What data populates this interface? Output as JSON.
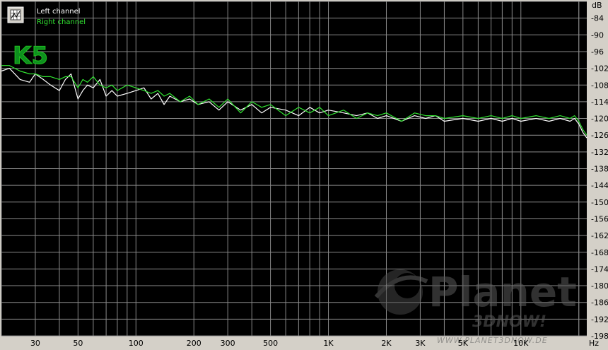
{
  "chart_data": {
    "type": "line",
    "title": "",
    "xlabel": "",
    "ylabel": "",
    "x_unit": "Hz",
    "y_unit": "dB",
    "x_scale": "log",
    "xlim": [
      20,
      22000
    ],
    "ylim": [
      -198,
      -78
    ],
    "grid": true,
    "legend": "top-left",
    "x_ticks": [
      {
        "value": 30,
        "label": "30"
      },
      {
        "value": 50,
        "label": "50"
      },
      {
        "value": 100,
        "label": "100"
      },
      {
        "value": 200,
        "label": "200"
      },
      {
        "value": 300,
        "label": "300"
      },
      {
        "value": 500,
        "label": "500"
      },
      {
        "value": 1000,
        "label": "1K"
      },
      {
        "value": 2000,
        "label": "2K"
      },
      {
        "value": 3000,
        "label": "3K"
      },
      {
        "value": 5000,
        "label": "5K"
      },
      {
        "value": 10000,
        "label": "10K"
      }
    ],
    "y_ticks": [
      {
        "value": -84,
        "label": "-84"
      },
      {
        "value": -90,
        "label": "-90"
      },
      {
        "value": -96,
        "label": "-96"
      },
      {
        "value": -102,
        "label": "-102"
      },
      {
        "value": -108,
        "label": "-108"
      },
      {
        "value": -114,
        "label": "-114"
      },
      {
        "value": -120,
        "label": "-120"
      },
      {
        "value": -126,
        "label": "-126"
      },
      {
        "value": -132,
        "label": "-132"
      },
      {
        "value": -138,
        "label": "-138"
      },
      {
        "value": -144,
        "label": "-144"
      },
      {
        "value": -150,
        "label": "-150"
      },
      {
        "value": -156,
        "label": "-156"
      },
      {
        "value": -162,
        "label": "-162"
      },
      {
        "value": -168,
        "label": "-168"
      },
      {
        "value": -174,
        "label": "-174"
      },
      {
        "value": -180,
        "label": "-180"
      },
      {
        "value": -186,
        "label": "-186"
      },
      {
        "value": -192,
        "label": "-192"
      },
      {
        "value": -198,
        "label": "-198"
      }
    ],
    "series": [
      {
        "name": "Left channel",
        "color": "#ffffff",
        "x": [
          20,
          22,
          25,
          28,
          30,
          33,
          36,
          40,
          43,
          46,
          50,
          53,
          56,
          60,
          65,
          70,
          75,
          80,
          90,
          100,
          110,
          120,
          130,
          140,
          150,
          170,
          190,
          210,
          240,
          270,
          300,
          350,
          400,
          450,
          500,
          600,
          700,
          800,
          900,
          1000,
          1200,
          1400,
          1600,
          1800,
          2000,
          2400,
          2800,
          3200,
          3600,
          4000,
          5000,
          6000,
          7000,
          8000,
          9000,
          10000,
          12000,
          14000,
          16000,
          18000,
          19000,
          20000,
          21000,
          22000
        ],
        "y": [
          -103,
          -102,
          -106,
          -107,
          -104,
          -106,
          -108,
          -110,
          -106,
          -104,
          -113,
          -110,
          -108,
          -109,
          -106,
          -112,
          -110,
          -112,
          -111,
          -110,
          -109,
          -113,
          -111,
          -115,
          -112,
          -114,
          -113,
          -115,
          -114,
          -117,
          -114,
          -117,
          -115,
          -118,
          -116,
          -117,
          -119,
          -116,
          -118,
          -117,
          -118,
          -119,
          -118,
          -120,
          -119,
          -121,
          -119,
          -120,
          -119,
          -121,
          -120,
          -121,
          -120,
          -121,
          -120,
          -121,
          -120,
          -121,
          -120,
          -121,
          -120,
          -122,
          -125,
          -127
        ]
      },
      {
        "name": "Right channel",
        "color": "#31e331",
        "x": [
          20,
          22,
          25,
          28,
          30,
          33,
          36,
          40,
          43,
          46,
          50,
          53,
          56,
          60,
          65,
          70,
          75,
          80,
          90,
          100,
          110,
          120,
          130,
          140,
          150,
          170,
          190,
          210,
          240,
          270,
          300,
          350,
          400,
          450,
          500,
          600,
          700,
          800,
          900,
          1000,
          1200,
          1400,
          1600,
          1800,
          2000,
          2400,
          2800,
          3200,
          3600,
          4000,
          5000,
          6000,
          7000,
          8000,
          9000,
          10000,
          12000,
          14000,
          16000,
          18000,
          19000,
          20000,
          21000,
          22000
        ],
        "y": [
          -101,
          -101,
          -103,
          -104,
          -104,
          -105,
          -105,
          -106,
          -105,
          -105,
          -109,
          -106,
          -107,
          -105,
          -108,
          -109,
          -108,
          -110,
          -108,
          -109,
          -110,
          -111,
          -110,
          -112,
          -111,
          -114,
          -112,
          -115,
          -113,
          -116,
          -113,
          -118,
          -114,
          -116,
          -115,
          -119,
          -116,
          -118,
          -116,
          -119,
          -117,
          -120,
          -118,
          -119,
          -118,
          -121,
          -118,
          -119,
          -119,
          -120,
          -119,
          -120,
          -119,
          -120,
          -119,
          -120,
          -119,
          -120,
          -119,
          -120,
          -119,
          -121,
          -124,
          -126
        ]
      }
    ]
  },
  "watermark": {
    "brand_line1": "Planet",
    "brand_line2": "3DNOW!",
    "url": "WWW.PLANET3DNOW.DE"
  },
  "badge": "K5",
  "colors": {
    "plot_background": "#000000",
    "grid": "#8a8a8a",
    "frame": "#d4d0c8",
    "left_channel": "#ffffff",
    "right_channel": "#31e331"
  }
}
